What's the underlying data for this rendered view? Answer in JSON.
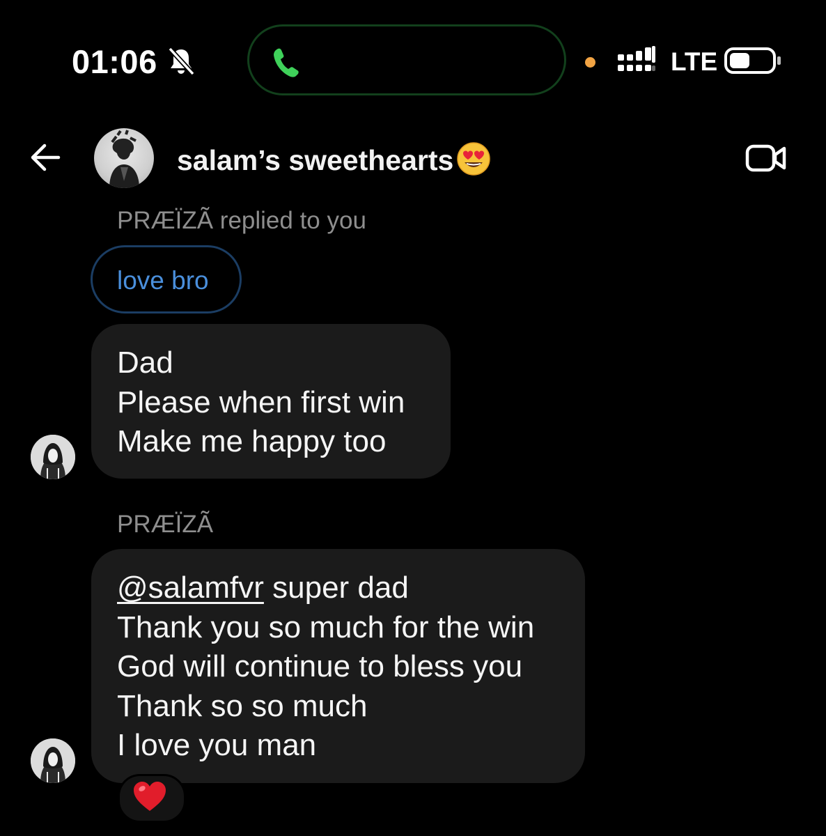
{
  "status_bar": {
    "time": "01:06",
    "network": "LTE",
    "icons": [
      "bell-muted-icon",
      "phone-call-icon",
      "privacy-dot-icon",
      "cellular-signal-icon",
      "battery-icon"
    ],
    "colors": {
      "call_green": "#3fd15a",
      "privacy_dot": "#f2a444"
    }
  },
  "header": {
    "title": "salam’s sweethearts",
    "title_emoji": "heart-eyes-emoji",
    "left_icon": "back-arrow-icon",
    "right_icon": "video-call-icon"
  },
  "reply": {
    "context": "PRÆÏZÃ replied to you",
    "quoted_text": "love bro",
    "colors": {
      "quoted_text": "#4a8fdc",
      "border": "#1b3d63"
    }
  },
  "messages": [
    {
      "lines": [
        "Dad",
        "Please when first win",
        "Make me happy too"
      ]
    },
    {
      "sender": "PRÆÏZÃ",
      "mention": "@salamfvr",
      "first_line_rest": " super dad",
      "lines": [
        "Thank you so much for the win",
        "God will continue to bless you",
        "Thank so so much",
        "I love you man"
      ],
      "reaction": "red-heart-emoji"
    }
  ],
  "theme": {
    "background": "#000000",
    "bubble": "#1b1b1b",
    "secondary_text": "#8e8e8e"
  }
}
